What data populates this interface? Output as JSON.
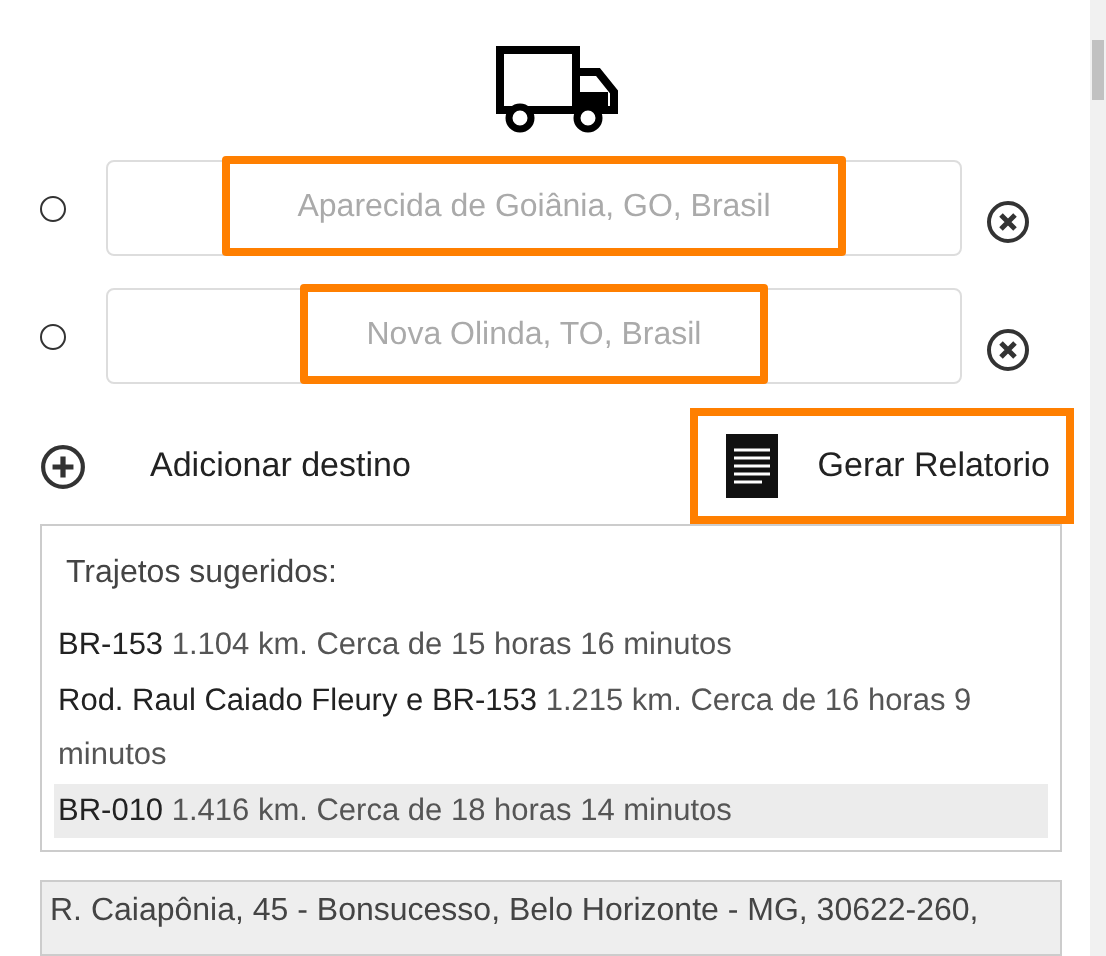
{
  "stops": [
    {
      "placeholder": "Aparecida de Goiânia, GO, Brasil",
      "selected": false,
      "annotated": true
    },
    {
      "placeholder": "Nova Olinda, TO, Brasil",
      "selected": false,
      "annotated": true
    }
  ],
  "add_destination": {
    "label": "Adicionar destino"
  },
  "report_button": {
    "label": "Gerar Relatorio",
    "annotated": true
  },
  "routes": {
    "title": "Trajetos sugeridos:",
    "items": [
      {
        "road": "BR-153",
        "details": "1.104 km. Cerca de 15 horas 16 minutos",
        "selected": false
      },
      {
        "road": "Rod. Raul Caiado Fleury e BR-153",
        "details": "1.215 km. Cerca de 16 horas 9 minutos",
        "selected": false
      },
      {
        "road": "BR-010",
        "details": "1.416 km. Cerca de 18 horas 14 minutos",
        "selected": true
      }
    ]
  },
  "address": {
    "value": "R. Caiapônia, 45 - Bonsucesso, Belo Horizonte - MG, 30622-260,"
  }
}
